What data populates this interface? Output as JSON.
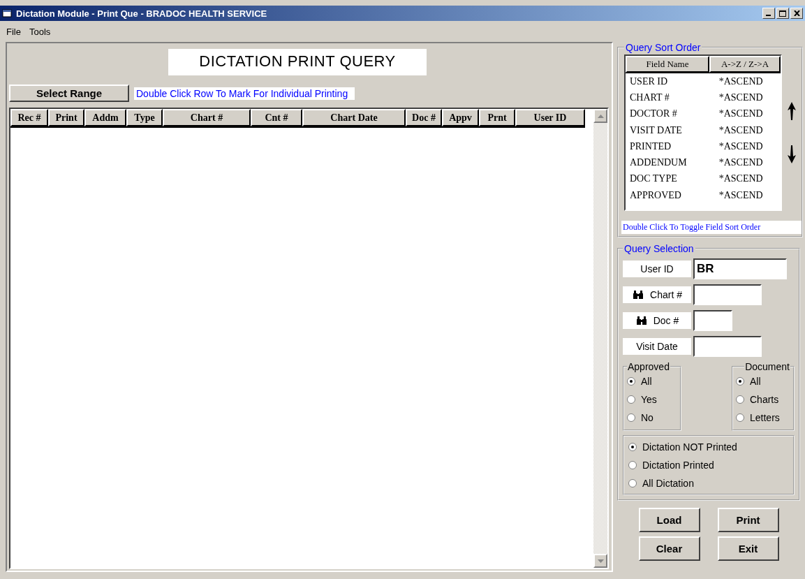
{
  "window": {
    "title": "Dictation Module - Print Que - BRADOC HEALTH SERVICE"
  },
  "menu": [
    "File",
    "Tools"
  ],
  "heading": "DICTATION PRINT QUERY",
  "select_range_button": "Select Range",
  "hint": "Double Click Row To Mark For Individual Printing",
  "table": {
    "columns": [
      "Rec #",
      "Print",
      "Addm",
      "Type",
      "Chart #",
      "Cnt #",
      "Chart Date",
      "Doc #",
      "Appv",
      "Prnt",
      "User ID"
    ]
  },
  "sort_order": {
    "title": "Query Sort Order",
    "columns": [
      "Field Name",
      "A->Z / Z->A"
    ],
    "rows": [
      {
        "field": "USER ID",
        "order": "*ASCEND"
      },
      {
        "field": "CHART #",
        "order": "*ASCEND"
      },
      {
        "field": "DOCTOR #",
        "order": "*ASCEND"
      },
      {
        "field": "VISIT DATE",
        "order": "*ASCEND"
      },
      {
        "field": "PRINTED",
        "order": "*ASCEND"
      },
      {
        "field": "ADDENDUM",
        "order": "*ASCEND"
      },
      {
        "field": "DOC TYPE",
        "order": "*ASCEND"
      },
      {
        "field": "APPROVED",
        "order": "*ASCEND"
      }
    ],
    "hint": "Double Click To Toggle Field Sort Order"
  },
  "query_selection": {
    "title": "Query Selection",
    "fields": [
      {
        "label": "User ID",
        "value": "BR",
        "kind": "plain"
      },
      {
        "label": "Chart #",
        "kind": "search"
      },
      {
        "label": "Doc #",
        "kind": "search"
      },
      {
        "label": "Visit Date",
        "kind": "plain"
      }
    ],
    "approved": {
      "title": "Approved",
      "options": [
        {
          "label": "All",
          "selected": true
        },
        {
          "label": "Yes",
          "selected": false
        },
        {
          "label": "No",
          "selected": false
        }
      ]
    },
    "document": {
      "title": "Document",
      "options": [
        {
          "label": "All",
          "selected": true
        },
        {
          "label": "Charts",
          "selected": false
        },
        {
          "label": "Letters",
          "selected": false
        }
      ]
    },
    "dictation": [
      {
        "label": "Dictation NOT Printed",
        "selected": true
      },
      {
        "label": "Dictation Printed",
        "selected": false
      },
      {
        "label": "All Dictation",
        "selected": false
      }
    ]
  },
  "buttons": [
    "Load",
    "Print",
    "Clear",
    "Exit"
  ]
}
